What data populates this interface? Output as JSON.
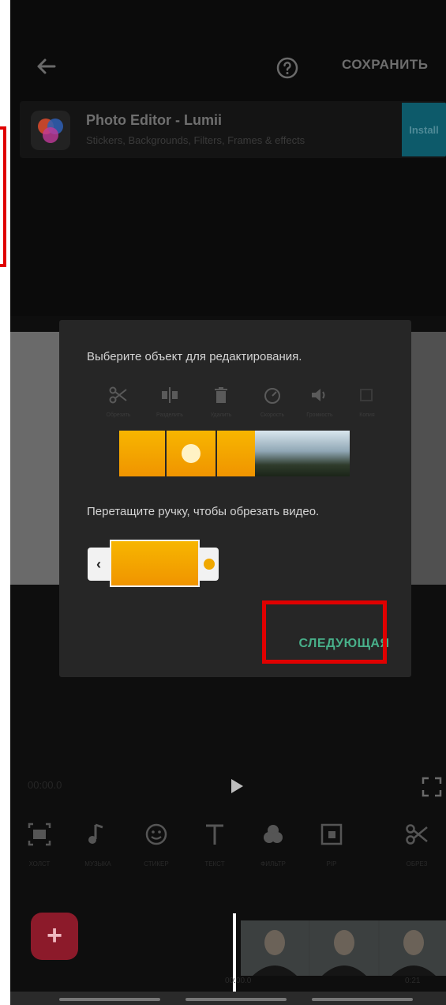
{
  "header": {
    "save_label": "СОХРАНИТЬ"
  },
  "ad": {
    "title": "Photo Editor - Lumii",
    "subtitle": "Stickers, Backgrounds, Filters, Frames & effects",
    "install_label": "Install"
  },
  "tutorial": {
    "select_hint": "Выберите объект для редактирования.",
    "drag_hint": "Перетащите ручку, чтобы обрезать видео.",
    "next_label": "СЛЕДУЮЩАЯ",
    "tools": [
      {
        "icon": "scissors-icon",
        "label": "Обрезать"
      },
      {
        "icon": "split-icon",
        "label": "Разделить"
      },
      {
        "icon": "trash-icon",
        "label": "Удалить"
      },
      {
        "icon": "speed-icon",
        "label": "Скорость"
      },
      {
        "icon": "volume-icon",
        "label": "Громкость"
      },
      {
        "icon": "copy-icon",
        "label": "Копия"
      }
    ]
  },
  "player": {
    "current_time": "00:00.0"
  },
  "toolbar": {
    "items": [
      {
        "icon": "canvas-icon",
        "label": "Холст"
      },
      {
        "icon": "music-icon",
        "label": "Музыка"
      },
      {
        "icon": "sticker-icon",
        "label": "Стикер"
      },
      {
        "icon": "text-icon",
        "label": "Текст"
      },
      {
        "icon": "filter-icon",
        "label": "Фильтр"
      },
      {
        "icon": "pip-icon",
        "label": "PIP"
      },
      {
        "icon": "scissors-icon",
        "label": "Обрез"
      }
    ]
  },
  "timeline": {
    "time_start": "00:00.0",
    "time_end": "0:21"
  },
  "colors": {
    "accent_next": "#48b08a",
    "highlight_frame": "#e00000",
    "add_button": "#8c1a2a"
  }
}
